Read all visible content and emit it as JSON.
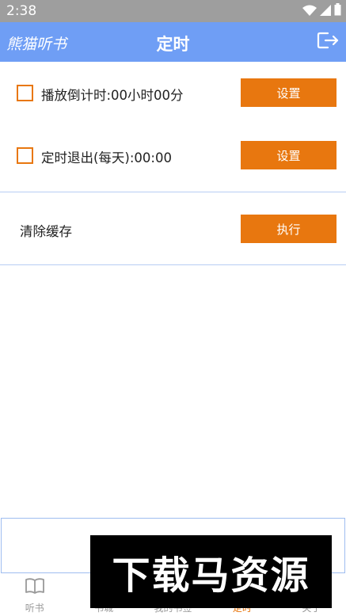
{
  "status_bar": {
    "time": "2:38",
    "icons": [
      "wifi-icon",
      "cellular-signal-icon",
      "battery-icon"
    ]
  },
  "app_bar": {
    "app_name": "熊猫听书",
    "title": "定时",
    "exit_icon": "exit-icon"
  },
  "settings": {
    "countdown": {
      "label": "播放倒计时:00小时00分",
      "checked": false,
      "button": "设置"
    },
    "daily_exit": {
      "label": "定时退出(每天):00:00",
      "checked": false,
      "button": "设置"
    },
    "clear_cache": {
      "label": "清除缓存",
      "button": "执行"
    }
  },
  "bottom_nav": {
    "items": [
      {
        "label": "听书",
        "icon": "book-icon"
      },
      {
        "label": "书城",
        "icon": "store-icon"
      },
      {
        "label": "我的书签",
        "icon": "bookmark-icon"
      },
      {
        "label": "定时",
        "icon": "clock-icon"
      },
      {
        "label": "关于",
        "icon": "info-icon"
      }
    ],
    "active_index": 3
  },
  "watermark": {
    "text": "下载马资源"
  },
  "colors": {
    "app_bar": "#6f9ef5",
    "accent": "#e8770f",
    "status_bar": "#9e9e9e",
    "divider": "#b7cdf3"
  }
}
